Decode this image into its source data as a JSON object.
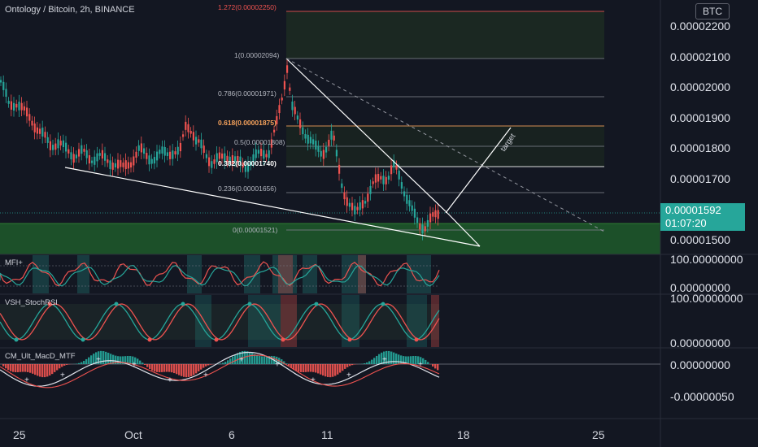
{
  "header": {
    "symbol_title": "Ontology / Bitcoin, 2h, BINANCE",
    "currency_button": "BTC"
  },
  "price_axis": {
    "labels": [
      "0.00002200",
      "0.00002100",
      "0.00002000",
      "0.00001900",
      "0.00001800",
      "0.00001700",
      "0.00001500"
    ]
  },
  "current_price": {
    "value": "0.00001592",
    "countdown": "01:07:20",
    "color": "#26a69a"
  },
  "fibonacci": {
    "levels": [
      {
        "label": "1.272(0.00002250)",
        "color": "#ef5350"
      },
      {
        "label": "1(0.00002094)",
        "color": "#787b86"
      },
      {
        "label": "0.786(0.00001971)",
        "color": "#787b86"
      },
      {
        "label": "0.618(0.00001875)",
        "color": "#f7a35c"
      },
      {
        "label": "0.5(0.00001808)",
        "color": "#787b86"
      },
      {
        "label": "0.382(0.00001740)",
        "color": "#ffffff"
      },
      {
        "label": "0.236(0.00001656)",
        "color": "#787b86"
      },
      {
        "label": "0(0.00001521)",
        "color": "#787b86"
      }
    ]
  },
  "annotations": {
    "target_text": "target"
  },
  "indicators": [
    {
      "name": "MFI+",
      "axis_top": "100.00000000",
      "axis_bottom": "0.00000000"
    },
    {
      "name": "VSH_StochRSI",
      "axis_top": "100.00000000",
      "axis_bottom": "0.00000000"
    },
    {
      "name": "CM_Ult_MacD_MTF",
      "axis_top": "0.00000000",
      "axis_bottom": "-0.00000050"
    }
  ],
  "time_axis": {
    "labels": [
      "25",
      "Oct",
      "6",
      "11",
      "18",
      "25"
    ]
  },
  "colors": {
    "background": "#131722",
    "bull": "#26a69a",
    "bear": "#ef5350",
    "support_zone": "#1e5a2a"
  }
}
